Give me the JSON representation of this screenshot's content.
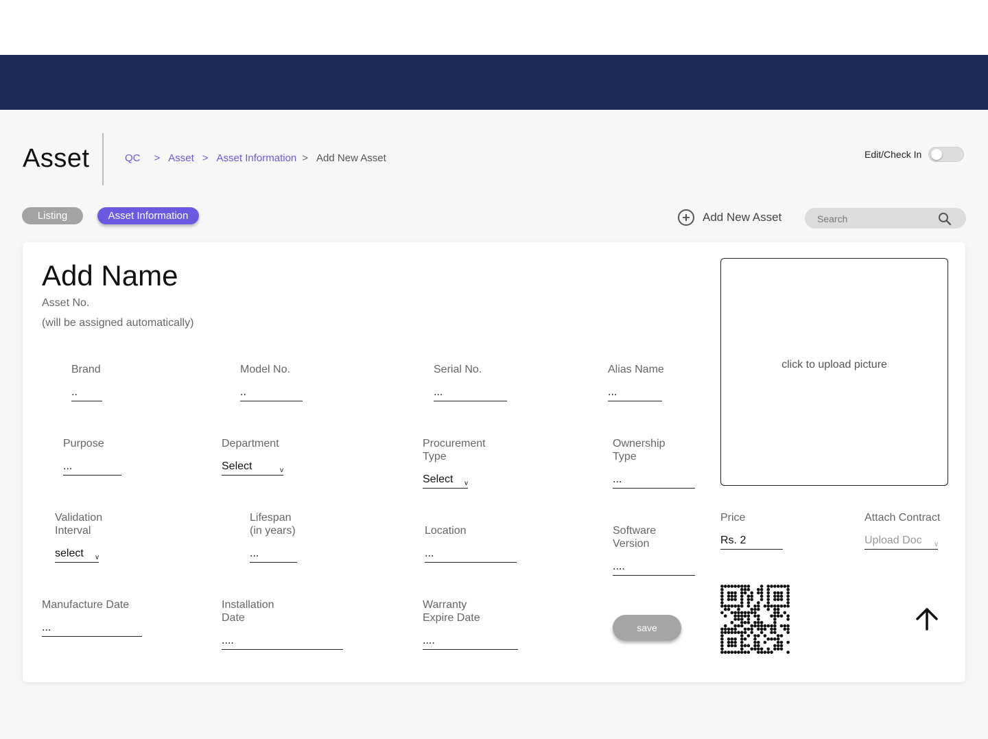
{
  "page": {
    "title": "Asset"
  },
  "breadcrumb": {
    "qc": "QC",
    "asset": "Asset",
    "asset_info": "Asset Information",
    "current": "Add New Asset",
    "sep": ">"
  },
  "toggle": {
    "label": "Edit/Check In",
    "on": false
  },
  "tabs": {
    "listing": "Listing",
    "asset_information": "Asset Information"
  },
  "toolbar": {
    "add_new": "Add New Asset",
    "search_placeholder": "Search"
  },
  "form": {
    "name": "Add Name",
    "asset_no_label": "Asset No.",
    "asset_no_note": "(will be assigned automatically)",
    "brand": {
      "label": "Brand",
      "value": ".."
    },
    "model_no": {
      "label": "Model No.",
      "value": ".."
    },
    "serial_no": {
      "label": "Serial No.",
      "value": "..."
    },
    "alias_name": {
      "label": "Alias Name",
      "value": "..."
    },
    "purpose": {
      "label": "Purpose",
      "value": "..."
    },
    "department": {
      "label": "Department",
      "value": "Select"
    },
    "procurement_type": {
      "label_1": "Procurement",
      "label_2": "Type",
      "value": "Select"
    },
    "ownership_type": {
      "label_1": "Ownership",
      "label_2": "Type",
      "value": "..."
    },
    "validation_interval": {
      "label_1": "Validation",
      "label_2": "Interval",
      "value": "select"
    },
    "lifespan": {
      "label_1": "Lifespan",
      "label_2": "(in years)",
      "value": "..."
    },
    "location": {
      "label": "Location",
      "value": "..."
    },
    "software_version": {
      "label_1": "Software",
      "label_2": "Version",
      "value": "...."
    },
    "price": {
      "label": "Price",
      "value": "Rs. 2"
    },
    "attach_contract": {
      "label": "Attach Contract",
      "value": "Upload Doc"
    },
    "manufacture_date": {
      "label": "Manufacture Date",
      "value": "..."
    },
    "installation_date": {
      "label_1": "Installation",
      "label_2": "Date",
      "value": "...."
    },
    "warranty_expire_date": {
      "label_1": "Warranty",
      "label_2": "Expire Date",
      "value": "...."
    },
    "upload_picture": "click to upload picture",
    "save": "save",
    "chevron": "v"
  },
  "colors": {
    "navbar": "#1e295a",
    "accent": "#6a5ae0",
    "pill_gray": "#a3a3a3"
  },
  "icons": [
    "plus-circle-icon",
    "search-icon",
    "chevron-down-icon",
    "qr-code-icon",
    "arrow-up-icon"
  ]
}
